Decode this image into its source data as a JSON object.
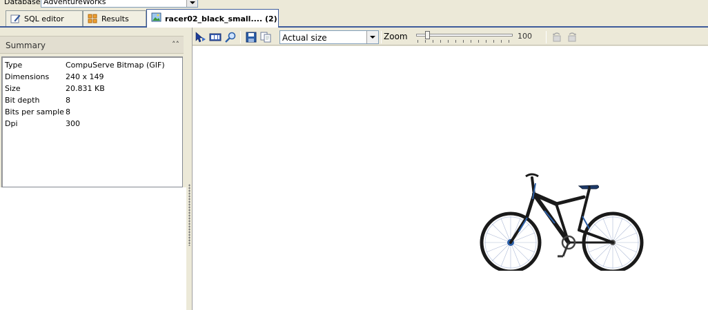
{
  "database_bar": {
    "label": "Database",
    "value": "AdventureWorks"
  },
  "tabs": [
    {
      "label": "SQL editor",
      "icon": "pencil-icon",
      "active": false
    },
    {
      "label": "Results",
      "icon": "grid-icon",
      "active": false
    },
    {
      "label": "racer02_black_small.... (2)",
      "icon": "image-icon",
      "active": true
    }
  ],
  "summary": {
    "title": "Summary",
    "rows": [
      {
        "key": "Type",
        "value": "CompuServe Bitmap (GIF)"
      },
      {
        "key": "Dimensions",
        "value": "240 x 149"
      },
      {
        "key": "Size",
        "value": "20.831 KB"
      },
      {
        "key": "Bit depth",
        "value": "8"
      },
      {
        "key": "Bits per sample",
        "value": "8"
      },
      {
        "key": "Dpi",
        "value": "300"
      }
    ]
  },
  "toolbar": {
    "size_mode": "Actual size",
    "zoom_label": "Zoom",
    "zoom_value": "100",
    "zoom_fraction": 0.1
  },
  "colors": {
    "accent": "#3c5a9a",
    "panel": "#ece9d8",
    "bike_frame": "#1a1a1a",
    "bike_detail": "#2b5fa8"
  }
}
